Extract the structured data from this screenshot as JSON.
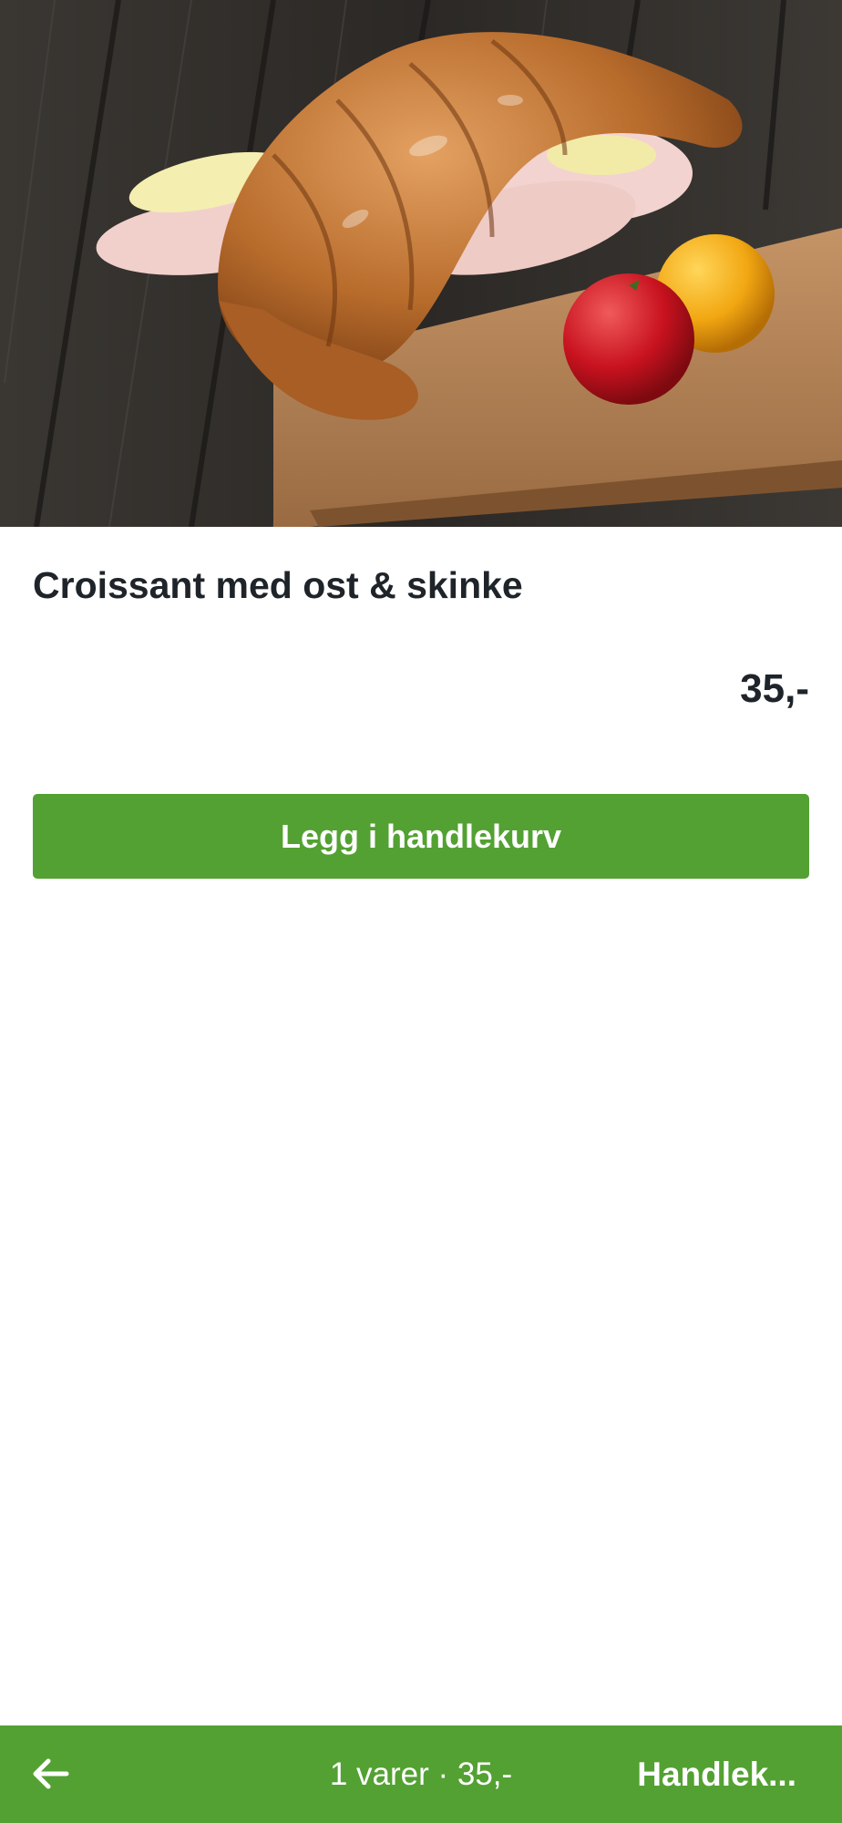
{
  "product": {
    "image_alt": "Croissant med ost & skinke",
    "title": "Croissant med ost & skinke",
    "price": "35,-"
  },
  "actions": {
    "add_to_cart_label": "Legg i handlekurv"
  },
  "bottom_bar": {
    "back_icon": "arrow-left-icon",
    "item_count": "1 varer",
    "separator": " · ",
    "total": "35,-",
    "cart_label": "Handlek..."
  },
  "colors": {
    "accent": "#53a132",
    "text": "#1e2429",
    "background": "#ffffff"
  }
}
